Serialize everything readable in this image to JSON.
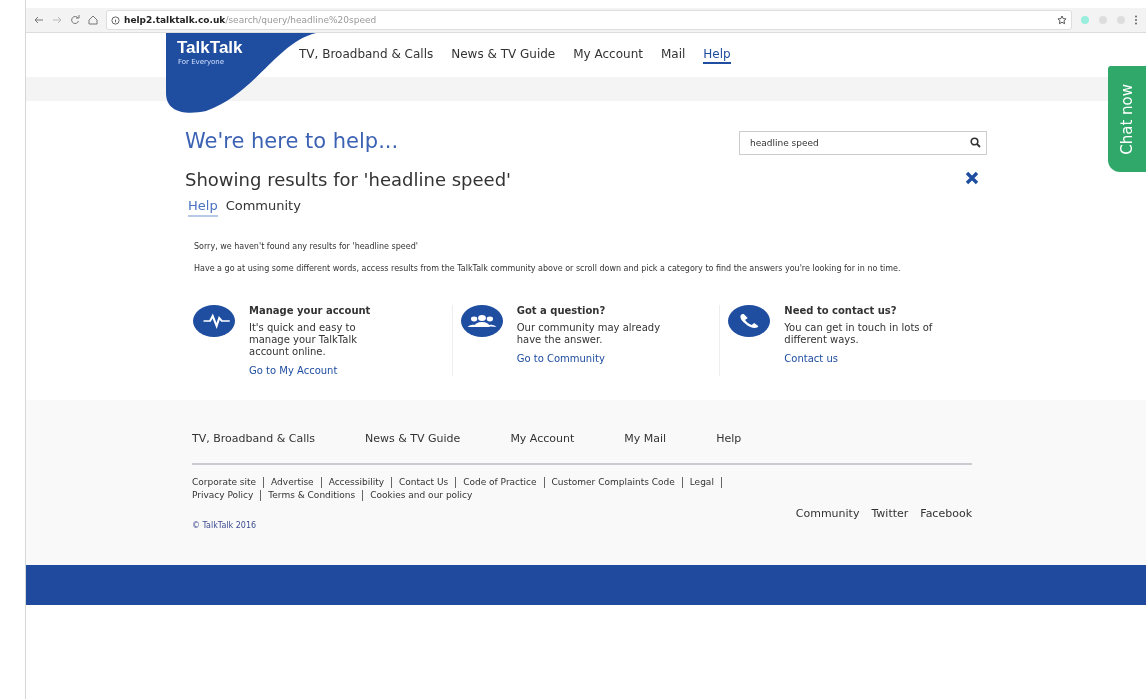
{
  "browser": {
    "url": "**help2.talktalk.co.uk**/search/query/headline%20speed"
  },
  "header": {
    "logo": {
      "name": "TalkTalk",
      "tagline": "For Everyone"
    },
    "nav": [
      {
        "label": "TV, Broadband & Calls",
        "selected": false
      },
      {
        "label": "News & TV Guide",
        "selected": false
      },
      {
        "label": "My Account",
        "selected": false
      },
      {
        "label": "Mail",
        "selected": false
      },
      {
        "label": "Help",
        "selected": true
      }
    ]
  },
  "chat": {
    "label": "Chat now"
  },
  "main": {
    "title": "We're here to help...",
    "search": {
      "value": "headline speed"
    },
    "results_heading": "Showing results for 'headline speed'",
    "tabs": [
      {
        "label": "Help",
        "selected": true
      },
      {
        "label": "Community",
        "selected": false
      }
    ],
    "no_results": "Sorry, we haven't found any results for 'headline speed'",
    "advice": "Have a go at using some different words, access results from the TalkTalk community above or scroll down and pick a category to find the answers you're looking for in no time.",
    "cards": [
      {
        "kind": "pulse",
        "title": "Manage your account",
        "text": "It's quick and easy to manage your TalkTalk account online.",
        "link": "Go to My Account"
      },
      {
        "kind": "people",
        "title": "Got a question?",
        "text": "Our community may already have the answer.",
        "link": "Go to Community"
      },
      {
        "kind": "phone",
        "title": "Need to contact us?",
        "text": "You can get in touch in lots of different ways.",
        "link": "Contact us"
      }
    ]
  },
  "footer": {
    "nav": [
      "TV, Broadband & Calls",
      "News & TV Guide",
      "My Account",
      "My Mail",
      "Help"
    ],
    "legal_rows": [
      [
        "Corporate site",
        "Advertise",
        "Accessibility",
        "Contact Us",
        "Code of Practice",
        "Customer Complaints Code",
        "Legal"
      ],
      [
        "Privacy Policy",
        "Terms & Conditions",
        "Cookies and our policy"
      ]
    ],
    "social": [
      "Community",
      "Twitter",
      "Facebook"
    ],
    "copyright": "© TalkTalk 2016"
  }
}
